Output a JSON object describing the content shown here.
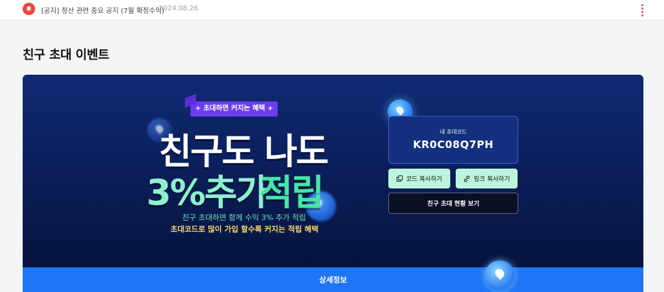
{
  "notice": {
    "text": "[공지] 정산 관련 중요 공지 (7월 확정수익)",
    "date": "2024.08.26"
  },
  "page": {
    "title": "친구 초대 이벤트"
  },
  "banner": {
    "tag": "+ 초대하면 커지는 혜택 +",
    "headline_line1": "친구도 나도",
    "headline_line2a": "3%추가",
    "headline_line2b": "적립",
    "sub_line1": "친구 초대하면 함께 수익 3% 추가 적립",
    "sub_line2": "초대코드로 많이 가입 할수록 커지는 적립 혜택",
    "code_label": "내 초대코드",
    "code_value": "KR0C08Q7PH",
    "copy_code_label": "코드 복사하기",
    "copy_link_label": "링크 복사하기",
    "status_label": "친구 초대 현황 보기"
  },
  "details": {
    "label": "상세정보"
  },
  "colors": {
    "banner_bg": "#0b1f5c",
    "accent_green": "#45e6a3",
    "accent_purple": "#6b3cf0",
    "details_blue": "#1e75f5",
    "notice_red": "#f0443c"
  }
}
